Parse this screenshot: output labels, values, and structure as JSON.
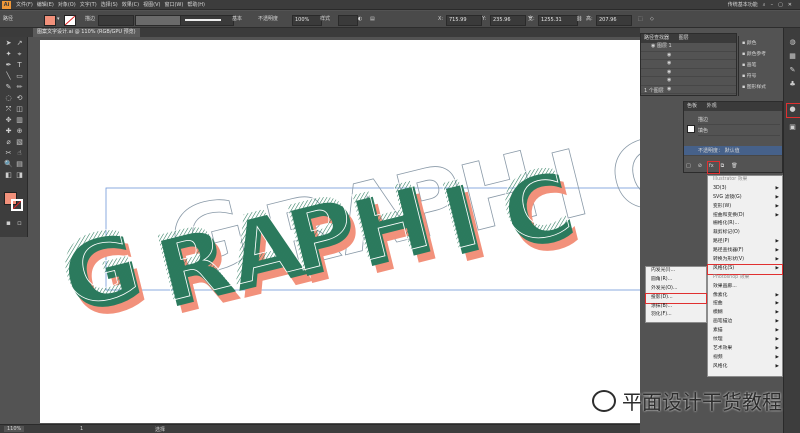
{
  "app": {
    "logo": "Ai"
  },
  "menubar": {
    "items": [
      "文件(F)",
      "编辑(E)",
      "对象(O)",
      "文字(T)",
      "选择(S)",
      "效果(C)",
      "视图(V)",
      "窗口(W)",
      "帮助(H)"
    ],
    "workspace": "传统基本功能"
  },
  "controlbar": {
    "mode_label": "路径",
    "fill_color": "#f2917b",
    "stroke_label": "描边",
    "profile_label": "等比",
    "preset_label": "基本",
    "opacity_label": "不透明度",
    "opacity_value": "100%",
    "style_label": "样式",
    "x_value": "715.99",
    "y_value": "235.96",
    "w_value": "1255.31",
    "h_value": "207.96"
  },
  "document": {
    "tab_title": "图案文字设计.ai @ 110% (RGB/GPU 预览)"
  },
  "statusbar": {
    "zoom": "110%",
    "page": "1",
    "tool_status": "选择"
  },
  "artwork": {
    "text": "GRAPHIC",
    "colors": {
      "green": "#2b7a5d",
      "salmon": "#f2917b",
      "outline": "#8a9aa8",
      "selection": "#6f97d8"
    }
  },
  "layers_panel": {
    "tabs": [
      "路径查找器",
      "图层"
    ],
    "rows": [
      "图层 1",
      "",
      "",
      "",
      "",
      ""
    ],
    "footer": "1 个图层"
  },
  "appearance_panel": {
    "tabs": [
      "色板",
      "外观"
    ],
    "rows": [
      "描边",
      "填色",
      "不透明度： 默认值"
    ],
    "footer_icons": [
      "new-icon",
      "clear-icon",
      "fx-icon",
      "duplicate-icon",
      "delete-icon"
    ]
  },
  "dock_panels": [
    {
      "icon": "align-icon",
      "label": "颜色"
    },
    {
      "icon": "swatch-icon",
      "label": "颜色参考"
    },
    {
      "icon": "brush-icon",
      "label": "画笔"
    },
    {
      "icon": "symbol-icon",
      "label": "符号"
    },
    {
      "icon": "graphic-icon",
      "label": "图形样式"
    }
  ],
  "effect_menu": {
    "section_illustrator": "Illustrator 效果",
    "items": [
      {
        "label": "3D(3)",
        "sub": true
      },
      {
        "label": "SVG 滤镜(G)",
        "sub": true
      },
      {
        "label": "变形(W)",
        "sub": true
      },
      {
        "label": "扭曲和变换(D)",
        "sub": true
      },
      {
        "label": "栅格化(R)...",
        "sub": false
      },
      {
        "label": "裁剪标记(O)",
        "sub": false
      },
      {
        "label": "路径(P)",
        "sub": true
      },
      {
        "label": "路径查找器(F)",
        "sub": true
      },
      {
        "label": "转换为形状(V)",
        "sub": true
      },
      {
        "label": "风格化(S)",
        "sub": true,
        "highlight": true
      }
    ],
    "section_photoshop": "Photoshop 效果",
    "ps_items": [
      {
        "label": "效果画廊...",
        "sub": false
      },
      {
        "label": "像素化",
        "sub": true
      },
      {
        "label": "扭曲",
        "sub": true
      },
      {
        "label": "模糊",
        "sub": true
      },
      {
        "label": "画笔描边",
        "sub": true
      },
      {
        "label": "素描",
        "sub": true
      },
      {
        "label": "纹理",
        "sub": true
      },
      {
        "label": "艺术效果",
        "sub": true
      },
      {
        "label": "视频",
        "sub": true
      },
      {
        "label": "风格化",
        "sub": true
      }
    ]
  },
  "stylize_submenu": {
    "items": [
      {
        "label": "内发光(I)...",
        "highlight": false
      },
      {
        "label": "圆角(R)...",
        "highlight": false
      },
      {
        "label": "外发光(O)...",
        "highlight": false
      },
      {
        "label": "投影(D)...",
        "highlight": true
      },
      {
        "label": "涂抹(B)...",
        "highlight": false
      },
      {
        "label": "羽化(F)...",
        "highlight": false
      }
    ]
  },
  "watermark": {
    "text": "平面设计干货教程"
  }
}
